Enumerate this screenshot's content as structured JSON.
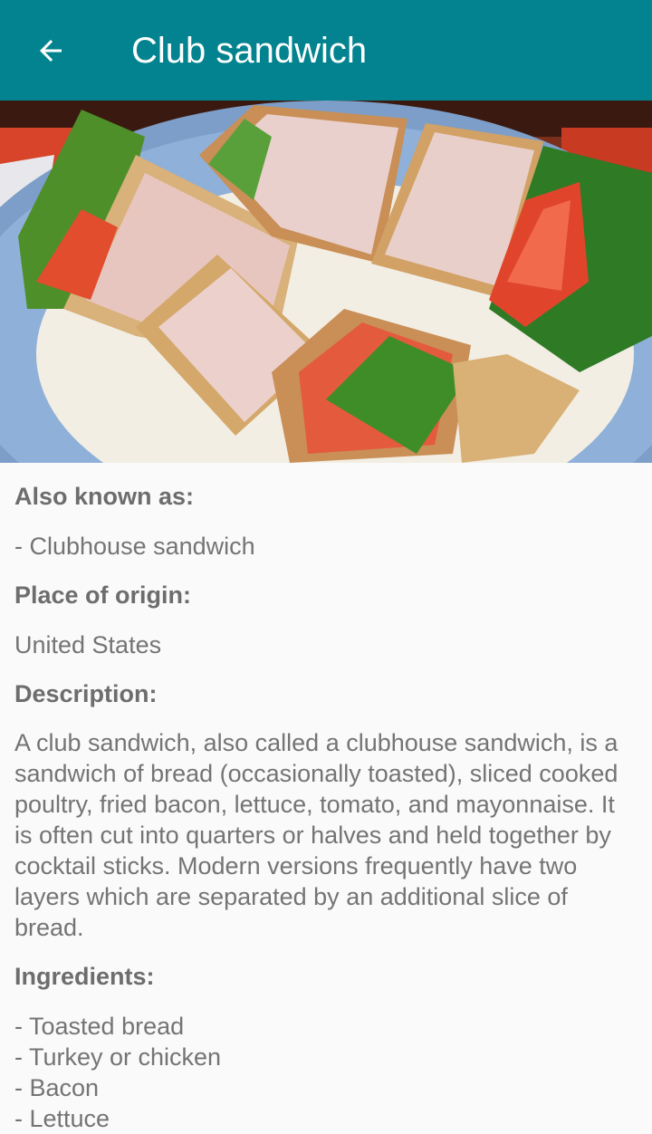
{
  "app_bar": {
    "title": "Club sandwich",
    "back_icon": "arrow-back-icon",
    "color": "#02838f"
  },
  "hero_image": {
    "alt": "Club sandwich"
  },
  "details": {
    "also_known_as_label": "Also known as:",
    "also_known_as": [
      "- Clubhouse sandwich"
    ],
    "place_of_origin_label": "Place of origin:",
    "place_of_origin": "United States",
    "description_label": "Description:",
    "description": "A club sandwich, also called a clubhouse sandwich, is a sandwich of bread (occasionally toasted), sliced cooked poultry, fried bacon, lettuce, tomato, and mayonnaise. It is often cut into quarters or halves and held together by cocktail sticks. Modern versions frequently have two layers which are separated by an additional slice of bread.",
    "ingredients_label": "Ingredients:",
    "ingredients": [
      "- Toasted bread",
      "- Turkey or chicken",
      "- Bacon",
      "- Lettuce"
    ]
  }
}
